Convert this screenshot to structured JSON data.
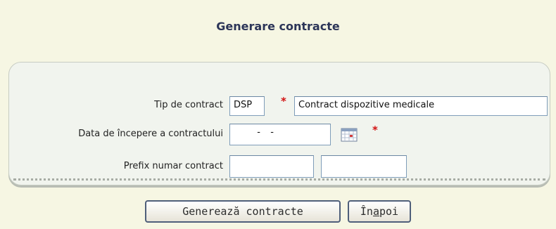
{
  "page": {
    "title": "Generare contracte"
  },
  "form": {
    "contract_type": {
      "label": "Tip de contract",
      "code": "DSP",
      "description": "Contract dispozitive medicale",
      "required_marker": "*"
    },
    "start_date": {
      "label": "Data de începere a contractului",
      "value": "  -  -",
      "required_marker": "*",
      "icon": "calendar-icon"
    },
    "contract_prefix": {
      "label": "Prefix numar contract",
      "value_1": "",
      "value_2": ""
    }
  },
  "actions": {
    "generate_label": "Generează contracte",
    "back_label": "Înapoi",
    "back_label_accesskey": "a"
  },
  "colors": {
    "background": "#f6f6e3",
    "title": "#2c3558",
    "required": "#d21111",
    "panel": "#f1f4ee"
  }
}
